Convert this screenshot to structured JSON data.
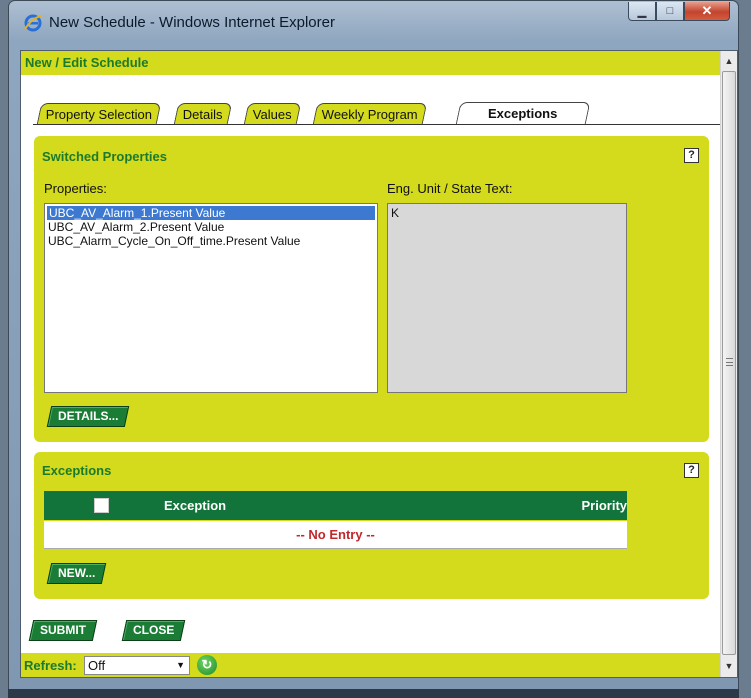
{
  "window": {
    "title": "New Schedule - Windows Internet Explorer"
  },
  "header": {
    "title": "New / Edit Schedule"
  },
  "tabs": [
    {
      "label": "Property Selection"
    },
    {
      "label": "Details"
    },
    {
      "label": "Values"
    },
    {
      "label": "Weekly Program"
    },
    {
      "label": "Exceptions"
    }
  ],
  "active_tab": "Exceptions",
  "switched": {
    "title": "Switched Properties",
    "properties_label": "Properties:",
    "units_label": "Eng. Unit / State Text:",
    "properties": [
      "UBC_AV_Alarm_1.Present Value",
      "UBC_AV_Alarm_2.Present Value",
      "UBC_Alarm_Cycle_On_Off_time.Present Value"
    ],
    "selected_index": 0,
    "unit_value": "K",
    "details_button": "DETAILS..."
  },
  "exceptions": {
    "title": "Exceptions",
    "columns": {
      "exception": "Exception",
      "priority": "Priority"
    },
    "empty_text": "-- No Entry --",
    "new_button": "NEW..."
  },
  "actions": {
    "submit": "SUBMIT",
    "close": "CLOSE"
  },
  "refresh": {
    "label": "Refresh:",
    "value": "Off"
  },
  "help_glyph": "?",
  "colors": {
    "accent_yellow": "#d4da1c",
    "accent_green": "#1b7d35",
    "title_green": "#1c7a2d",
    "empty_red": "#c0282d",
    "selection_blue": "#3d79d1"
  },
  "icons": {
    "browser": "ie-icon",
    "help": "help-icon",
    "refresh": "refresh-icon"
  }
}
